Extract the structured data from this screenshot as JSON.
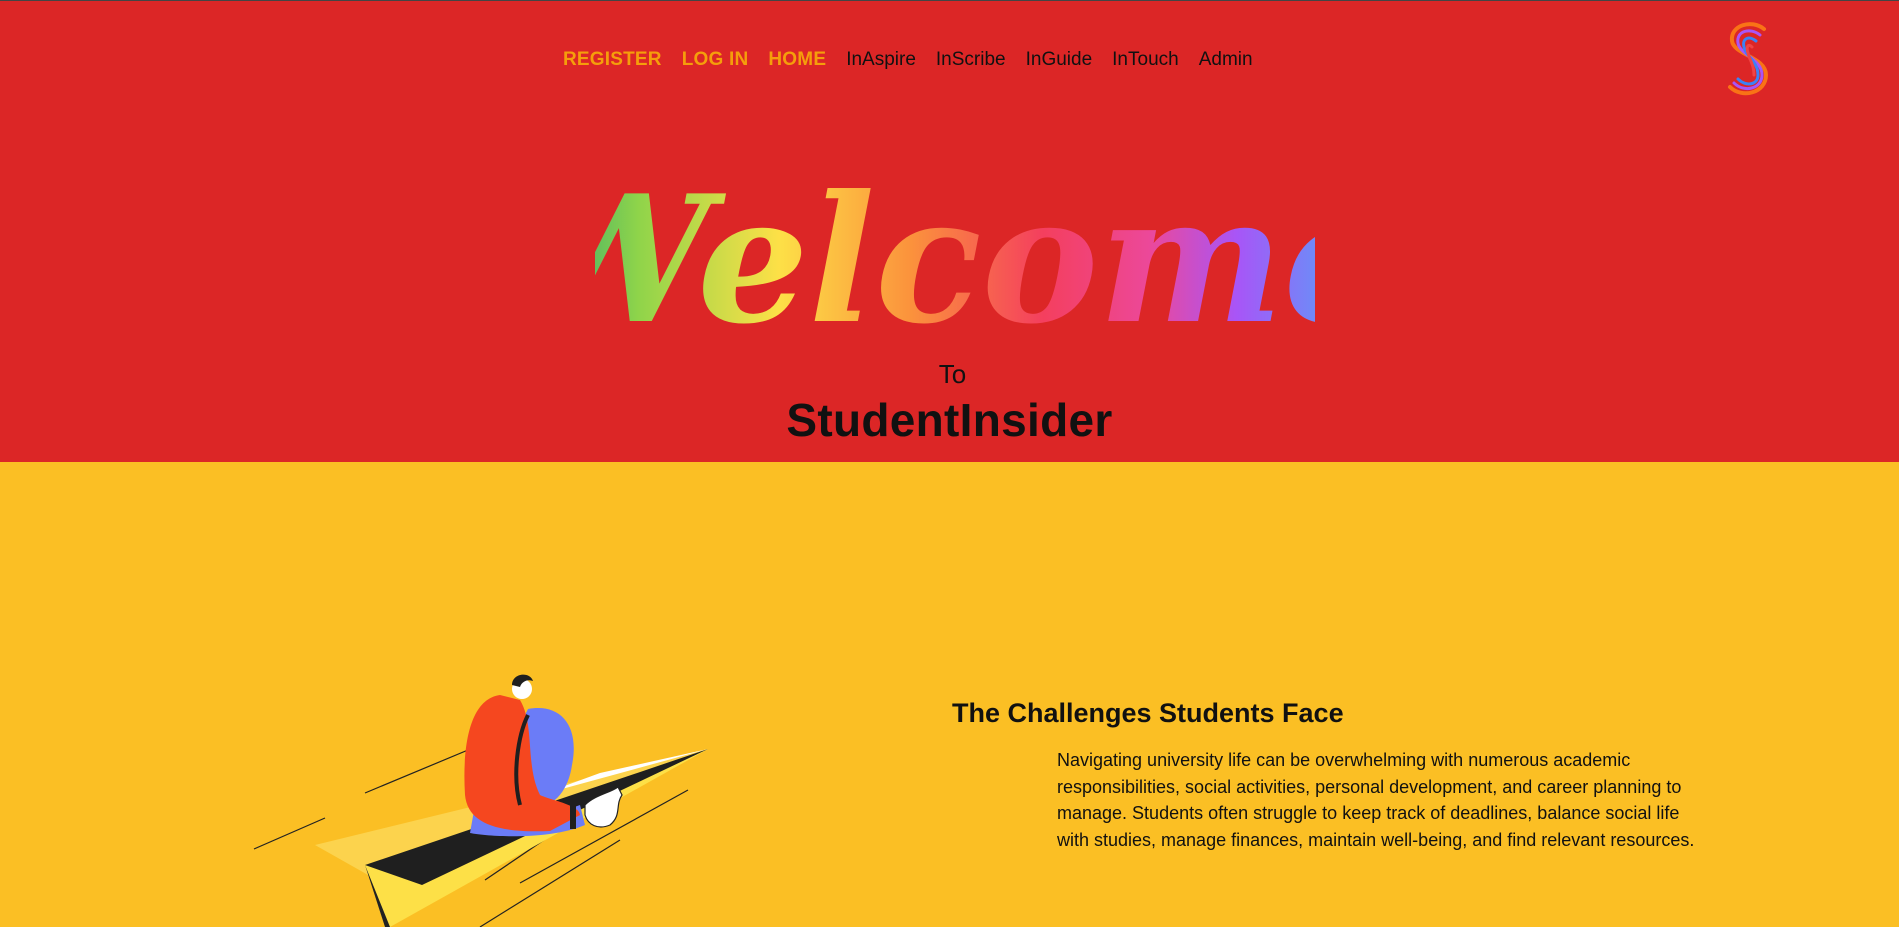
{
  "nav": {
    "register": "REGISTER",
    "login": "LOG IN",
    "home": "HOME",
    "inaspire": "InAspire",
    "inscribe": "InScribe",
    "inguide": "InGuide",
    "intouch": "InTouch",
    "admin": "Admin"
  },
  "hero": {
    "welcome": "Welcome",
    "to": "To",
    "brand": "StudentInsider"
  },
  "challenges": {
    "title": "The Challenges Students Face",
    "body": "Navigating university life can be overwhelming with numerous academic responsibilities, social activities, personal development, and career planning to manage. Students often struggle to keep track of deadlines, balance social life with studies, manage finances, maintain well-being, and find relevant resources."
  },
  "icons": {
    "logo": "s-logo-icon",
    "illustration": "student-on-paper-plane-illustration"
  },
  "colors": {
    "hero_bg": "#dc2626",
    "section_bg": "#fbbf24",
    "nav_accent": "#f59e0b",
    "text": "#111111"
  }
}
